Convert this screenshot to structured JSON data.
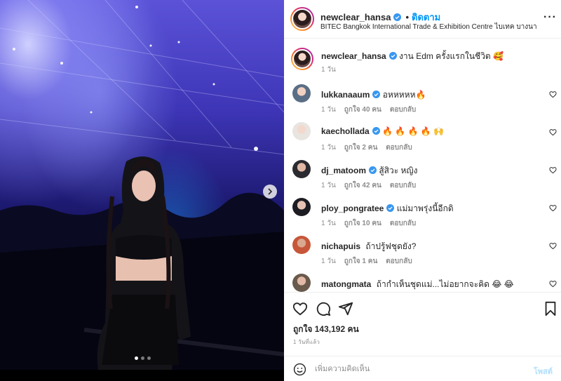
{
  "post": {
    "username": "newclear_hansa",
    "follow_label": "ติดตาม",
    "bullet": "•",
    "location": "BITEC Bangkok International Trade & Exhibition Centre ไบเทค บางนา",
    "more_label": "···",
    "caption": "งาน Edm ครั้งแรกในชีวิต 🥰",
    "caption_time": "1 วัน",
    "likes": "ถูกใจ 143,192 คน",
    "post_time": "1 วันที่แล้ว"
  },
  "comments": [
    {
      "username": "lukkanaaum",
      "text": "อหหหหห🔥",
      "time": "1 วัน",
      "likes": "ถูกใจ 40 คน",
      "reply": "ตอบกลับ",
      "verified": true
    },
    {
      "username": "kaechollada",
      "text": "🔥 🔥 🔥 🔥 🙌",
      "time": "1 วัน",
      "likes": "ถูกใจ 2 คน",
      "reply": "ตอบกลับ",
      "verified": true
    },
    {
      "username": "dj_matoom",
      "text": "สู้สิวะ หญิง",
      "time": "1 วัน",
      "likes": "ถูกใจ 42 คน",
      "reply": "ตอบกลับ",
      "verified": true
    },
    {
      "username": "ploy_pongratee",
      "text": "แม่มาพรุ่งนี้อีกดิ",
      "time": "1 วัน",
      "likes": "ถูกใจ 10 คน",
      "reply": "ตอบกลับ",
      "verified": true
    },
    {
      "username": "nichapuis",
      "text": "ถ้าปรู้ฟชุดยัง?",
      "time": "1 วัน",
      "likes": "ถูกใจ 1 คน",
      "reply": "ตอบกลับ",
      "verified": false
    },
    {
      "username": "matongmata",
      "text": "ถ้ากำเห็นชุดแม่...ไม่อยากจะคิด 😂 😂",
      "time": "",
      "likes": "",
      "reply": "",
      "verified": false
    }
  ],
  "composer": {
    "placeholder": "เพิ่มความคิดเห็น",
    "post_label": "โพสต์"
  },
  "carousel": {
    "slide_count": 3,
    "active_slide": 1
  },
  "colors": {
    "accent": "#0095f6",
    "post_disabled": "#b2dffc",
    "verified": "#3897f0",
    "fire": "#f56b2a"
  },
  "icons": [
    "verified-icon",
    "more-options-icon",
    "heart-icon",
    "comment-icon",
    "share-icon",
    "bookmark-icon",
    "emoji-icon",
    "chevron-right-icon"
  ]
}
